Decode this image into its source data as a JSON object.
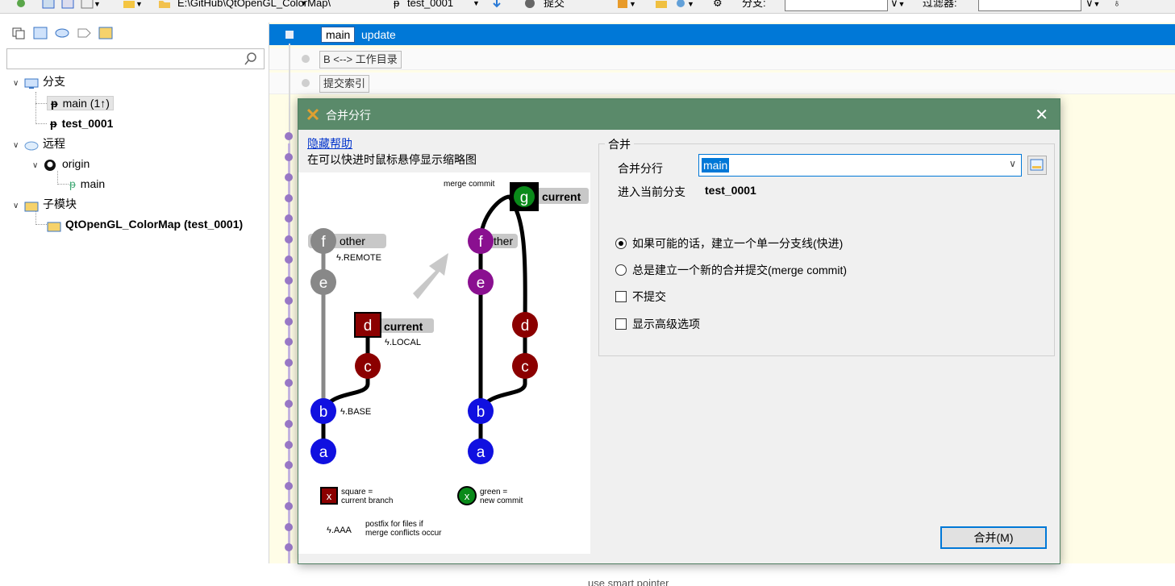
{
  "toolbar": {
    "path": "E:\\GitHub\\QtOpenGL_ColorMap\\",
    "branch": "test_0001",
    "commit_label": "提交",
    "branch_filter_label": "分支:",
    "filter_label": "过滤器:",
    "branch_filter_value": "",
    "filter_value": ""
  },
  "left": {
    "search_placeholder": "",
    "tree": {
      "branches_label": "分支",
      "branch_main": "main (1↑)",
      "branch_test": "test_0001",
      "remote_label": "远程",
      "origin_label": "origin",
      "origin_main": "main",
      "submodules_label": "子模块",
      "submodule_item": "QtOpenGL_ColorMap (test_0001)"
    }
  },
  "graph": {
    "selected_tag": "main",
    "selected_msg": "update",
    "row2": "B <--> 工作目录",
    "row3": "提交索引",
    "bottom_partial": "use smart pointer"
  },
  "dialog": {
    "title": "合并分行",
    "hide_help": "隐藏帮助",
    "hint": "在可以快进时鼠标悬停显示缩略图",
    "illustration": {
      "merge_commit": "merge commit",
      "current": "current",
      "other": "other",
      "other_partial": "ther",
      "remote": "ϟ.REMOTE",
      "local": "ϟ.LOCAL",
      "base": "ϟ.BASE",
      "legend_square": "square =",
      "legend_square2": "current branch",
      "legend_green": "green =",
      "legend_green2": "new commit",
      "legend_x": "x",
      "postfix": "ϟ.AAA",
      "postfix_desc1": "postfix for files if",
      "postfix_desc2": "merge conflicts occur",
      "nodes": {
        "a": "a",
        "b": "b",
        "c": "c",
        "d": "d",
        "e": "e",
        "f": "f",
        "g": "g"
      }
    },
    "group_title": "合并",
    "merge_branch_label": "合并分行",
    "merge_branch_value": "main",
    "into_label": "进入当前分支",
    "into_value": "test_0001",
    "option_ff": "如果可能的话，建立一个单一分支线(快进)",
    "option_merge_commit": "总是建立一个新的合并提交(merge commit)",
    "option_no_commit": "不提交",
    "option_advanced": "显示高级选项",
    "ok_button": "合并(M)"
  },
  "colors": {
    "selection": "#0078d7",
    "title_bar": "#5a8a6a",
    "graph_dot": "#9a79c8",
    "graph_bg": "#fffde7"
  }
}
